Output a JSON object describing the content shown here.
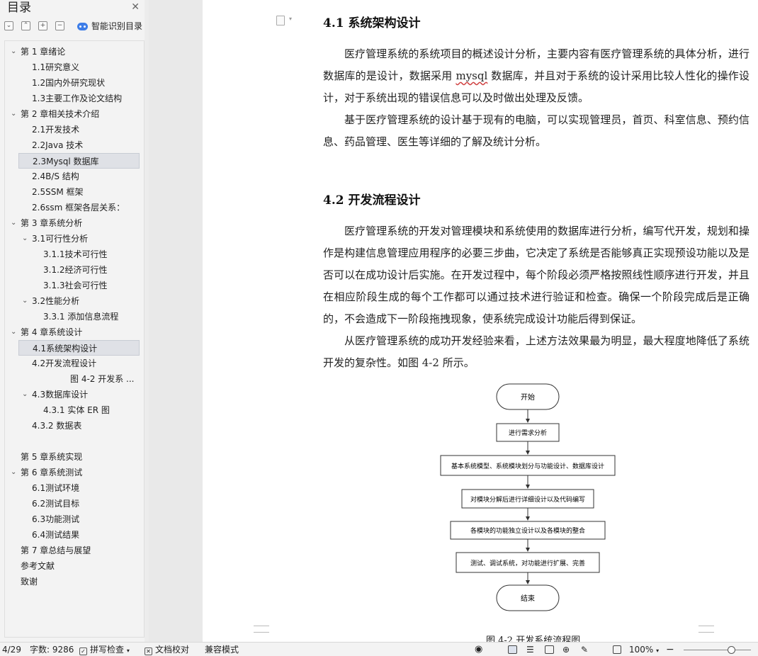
{
  "sidebar": {
    "title": "目录",
    "smart_toc_label": "智能识别目录",
    "items": [
      {
        "label": "第 1 章绪论",
        "level": 0,
        "arrow": true
      },
      {
        "label": "1.1研究意义",
        "level": 1
      },
      {
        "label": "1.2国内外研究现状",
        "level": 1
      },
      {
        "label": "1.3主要工作及论文结构",
        "level": 1
      },
      {
        "label": "第 2 章相关技术介绍",
        "level": 0,
        "arrow": true
      },
      {
        "label": "2.1开发技术",
        "level": 1
      },
      {
        "label": "2.2Java 技术",
        "level": 1
      },
      {
        "label": "2.3Mysql 数据库",
        "level": 1,
        "selected": true
      },
      {
        "label": "2.4B/S 结构",
        "level": 1
      },
      {
        "label": "2.5SSM 框架",
        "level": 1
      },
      {
        "label": "2.6ssm 框架各层关系：",
        "level": 1
      },
      {
        "label": "第 3 章系统分析",
        "level": 0,
        "arrow": true
      },
      {
        "label": "3.1可行性分析",
        "level": 1,
        "arrow": true
      },
      {
        "label": "3.1.1技术可行性",
        "level": 2
      },
      {
        "label": "3.1.2经济可行性",
        "level": 2
      },
      {
        "label": "3.1.3社会可行性",
        "level": 2
      },
      {
        "label": "3.2性能分析",
        "level": 1,
        "arrow": true
      },
      {
        "label": "3.3.1 添加信息流程",
        "level": 2
      },
      {
        "label": "第 4 章系统设计",
        "level": 0,
        "arrow": true
      },
      {
        "label": "4.1系统架构设计",
        "level": 1,
        "selected": true
      },
      {
        "label": "4.2开发流程设计",
        "level": 1
      },
      {
        "label": "图 4-2 开发系 ...",
        "level": 3
      },
      {
        "label": "4.3数据库设计",
        "level": 1,
        "arrow": true
      },
      {
        "label": "4.3.1 实体 ER 图",
        "level": 2
      },
      {
        "label": "4.3.2 数据表",
        "level": 1
      },
      {
        "label": "",
        "level": 0
      },
      {
        "label": "第 5 章系统实现",
        "level": 0
      },
      {
        "label": "第 6 章系统测试",
        "level": 0,
        "arrow": true
      },
      {
        "label": "6.1测试环境",
        "level": 1
      },
      {
        "label": "6.2测试目标",
        "level": 1
      },
      {
        "label": "6.3功能测试",
        "level": 1
      },
      {
        "label": "6.4测试结果",
        "level": 1
      },
      {
        "label": "第 7 章总结与展望",
        "level": 0
      },
      {
        "label": "参考文献",
        "level": 0
      },
      {
        "label": "致谢",
        "level": 0
      }
    ]
  },
  "document": {
    "h1": "4.1  系统架构设计",
    "p1_before": "医疗管理系统的系统项目的概述设计分析，主要内容有医疗管理系统的具体分析，进行数据库的是设计，数据采用 ",
    "p1_spell": "mysql",
    "p1_after": " 数据库，并且对于系统的设计采用比较人性化的操作设计，对于系统出现的错误信息可以及时做出处理及反馈。",
    "p2": "基于医疗管理系统的设计基于现有的电脑，可以实现管理员，首页、科室信息、预约信息、药品管理、医生等详细的了解及统计分析。",
    "h2": "4.2  开发流程设计",
    "p3": "医疗管理系统的开发对管理模块和系统使用的数据库进行分析，编写代开发，规划和操作是构建信息管理应用程序的必要三步曲，它决定了系统是否能够真正实现预设功能以及是否可以在成功设计后实施。在开发过程中，每个阶段必须严格按照线性顺序进行开发，并且在相应阶段生成的每个工作都可以通过技术进行验证和检查。确保一个阶段完成后是正确的，不会造成下一阶段拖拽现象，使系统完成设计功能后得到保证。",
    "p4": "从医疗管理系统的成功开发经验来看，上述方法效果最为明显，最大程度地降低了系统开发的复杂性。如图 4-2 所示。",
    "flow": {
      "start": "开始",
      "steps": [
        "进行需求分析",
        "基本系统模型、系统模块划分与功能设计、数据库设计",
        "对模块分解后进行详细设计以及代码编写",
        "各模块的功能独立设计以及各模块的整合",
        "测试、调试系统，对功能进行扩展、完善"
      ],
      "end": "结束"
    },
    "caption": "图 4-2 开发系统流程图"
  },
  "status": {
    "page": "4/29",
    "word_count": "字数: 9286",
    "spell_check": "拼写检查",
    "doc_proof": "文档校对",
    "compat_mode": "兼容模式",
    "zoom": "100%"
  },
  "colors": {
    "accent": "#3d7de8",
    "selected_bg": "#dfe1e6",
    "spell_underline": "#d04040"
  }
}
